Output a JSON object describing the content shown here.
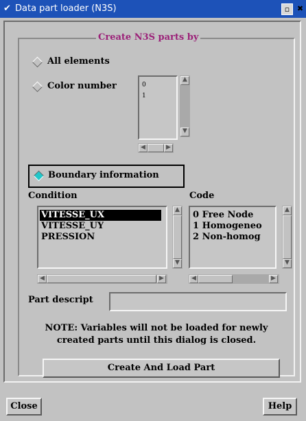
{
  "window": {
    "title": "Data part loader (N3S)",
    "menu_icon": "✔",
    "maximize_icon": "▫",
    "close_icon": "✖"
  },
  "group": {
    "legend": "Create N3S parts by"
  },
  "options": {
    "all_elements": "All elements",
    "color_number": "Color number",
    "boundary_information": "Boundary information",
    "selected": "boundary_information"
  },
  "color_list": {
    "items": [
      "0",
      "1"
    ]
  },
  "condition": {
    "label": "Condition",
    "items": [
      "VITESSE_UX",
      "VITESSE_UY",
      "PRESSION"
    ],
    "selected_index": 0
  },
  "code": {
    "label": "Code",
    "items": [
      "0 Free Node",
      "1 Homogeneo",
      "2 Non-homog"
    ]
  },
  "part_description": {
    "label": "Part descript",
    "value": ""
  },
  "note": {
    "line1": "NOTE: Variables will not be loaded for newly",
    "line2": "created parts until this dialog is closed."
  },
  "buttons": {
    "create_load": "Create And Load Part",
    "close": "Close",
    "help": "Help"
  },
  "colors": {
    "titlebar": "#1d52b8",
    "legend_text": "#9b2078",
    "radio_selected": "#22c7c9",
    "background": "#c2c2c2"
  }
}
